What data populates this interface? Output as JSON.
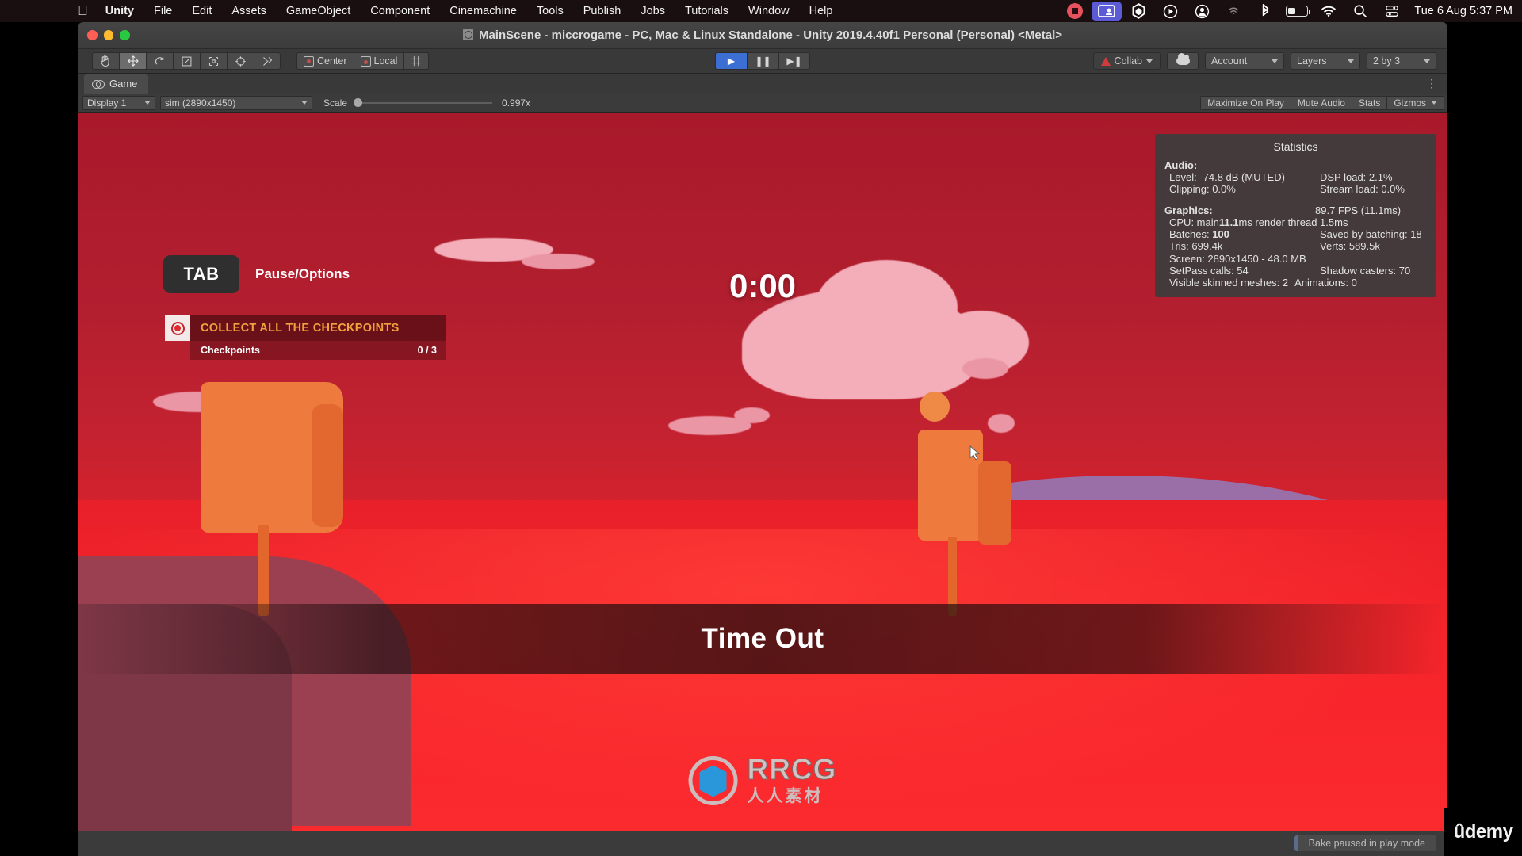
{
  "macos": {
    "apple_icon": "apple-logo",
    "menus": [
      {
        "label": "Unity",
        "bold": true
      },
      {
        "label": "File",
        "bold": false
      },
      {
        "label": "Edit",
        "bold": false
      },
      {
        "label": "Assets",
        "bold": false
      },
      {
        "label": "GameObject",
        "bold": false
      },
      {
        "label": "Component",
        "bold": false
      },
      {
        "label": "Cinemachine",
        "bold": false
      },
      {
        "label": "Tools",
        "bold": false
      },
      {
        "label": "Publish",
        "bold": false
      },
      {
        "label": "Jobs",
        "bold": false
      },
      {
        "label": "Tutorials",
        "bold": false
      },
      {
        "label": "Window",
        "bold": false
      },
      {
        "label": "Help",
        "bold": false
      }
    ],
    "status_icons": [
      "record-stop-icon",
      "screen-share-icon",
      "unity-hub-icon",
      "play-circle-icon",
      "account-circle-icon",
      "airplay-icon",
      "bluetooth-icon",
      "battery-icon",
      "wifi-icon",
      "spotlight-search-icon",
      "control-center-icon"
    ],
    "clock": "Tue 6 Aug  5:37 PM"
  },
  "window": {
    "title": "MainScene - miccrogame - PC, Mac & Linux Standalone - Unity 2019.4.40f1 Personal (Personal) <Metal>"
  },
  "toolbar": {
    "transform_tools": [
      {
        "name": "hand-tool",
        "glyph": "✋",
        "active": false
      },
      {
        "name": "move-tool",
        "glyph": "✛",
        "active": true
      },
      {
        "name": "rotate-tool",
        "glyph": "⟳",
        "active": false
      },
      {
        "name": "scale-tool",
        "glyph": "⤢",
        "active": false
      },
      {
        "name": "rect-tool",
        "glyph": "⬚",
        "active": false
      },
      {
        "name": "transform-tool",
        "glyph": "⊕",
        "active": false
      },
      {
        "name": "custom-tool",
        "glyph": "⚒",
        "active": false
      }
    ],
    "pivot_label": "Center",
    "space_label": "Local",
    "grid_label": "#",
    "play_label": "▶",
    "pause_label": "❚❚",
    "step_label": "▶❚",
    "collab_label": "Collab",
    "cloud_label": "cloud-icon",
    "account_label": "Account",
    "layers_label": "Layers",
    "layout_label": "2 by 3"
  },
  "game_panel": {
    "tab_label": "Game",
    "tab_icon": "gamepad-icon",
    "display_label": "Display 1",
    "resolution_label": "sim (2890x1450)",
    "scale_label": "Scale",
    "scale_value": "0.997x",
    "maximize_label": "Maximize On Play",
    "mute_label": "Mute Audio",
    "stats_label": "Stats",
    "gizmos_label": "Gizmos"
  },
  "statistics": {
    "title": "Statistics",
    "audio_header": "Audio:",
    "audio_level": "Level: -74.8 dB (MUTED)",
    "audio_dsp": "DSP load: 2.1%",
    "audio_clipping": "Clipping: 0.0%",
    "audio_stream": "Stream load: 0.0%",
    "graphics_header": "Graphics:",
    "fps": "89.7 FPS (11.1ms)",
    "cpu_prefix": "CPU: main ",
    "cpu_main": "11.1",
    "cpu_suffix": "ms  render thread 1.5ms",
    "batches_prefix": "Batches: ",
    "batches_value": "100",
    "saved_batching": "Saved by batching: 18",
    "tris": "Tris: 699.4k",
    "verts": "Verts: 589.5k",
    "screen": "Screen: 2890x1450 - 48.0 MB",
    "setpass": "SetPass calls: 54",
    "shadow_casters": "Shadow casters: 70",
    "skinned_meshes": "Visible skinned meshes: 2",
    "animations": "Animations: 0"
  },
  "hud": {
    "tab_key": "TAB",
    "pause_label": "Pause/Options",
    "objective_icon": "checkpoint-target-icon",
    "objective_title": "COLLECT ALL THE CHECKPOINTS",
    "objective_sub_label": "Checkpoints",
    "objective_sub_value": "0 / 3",
    "timer": "0:00",
    "banner": "Time Out"
  },
  "watermarks": {
    "rrcg_text": "RRCG",
    "rrcg_sub": "人人素材",
    "udemy": "ûdemy"
  },
  "status_bar": {
    "bake_status": "Bake paused in play mode"
  },
  "colors": {
    "accent_blue": "#3b6fd4",
    "objective_orange": "#f0a23c",
    "sky_red": "#b31f2f",
    "collab_warn": "#d23b3b"
  }
}
